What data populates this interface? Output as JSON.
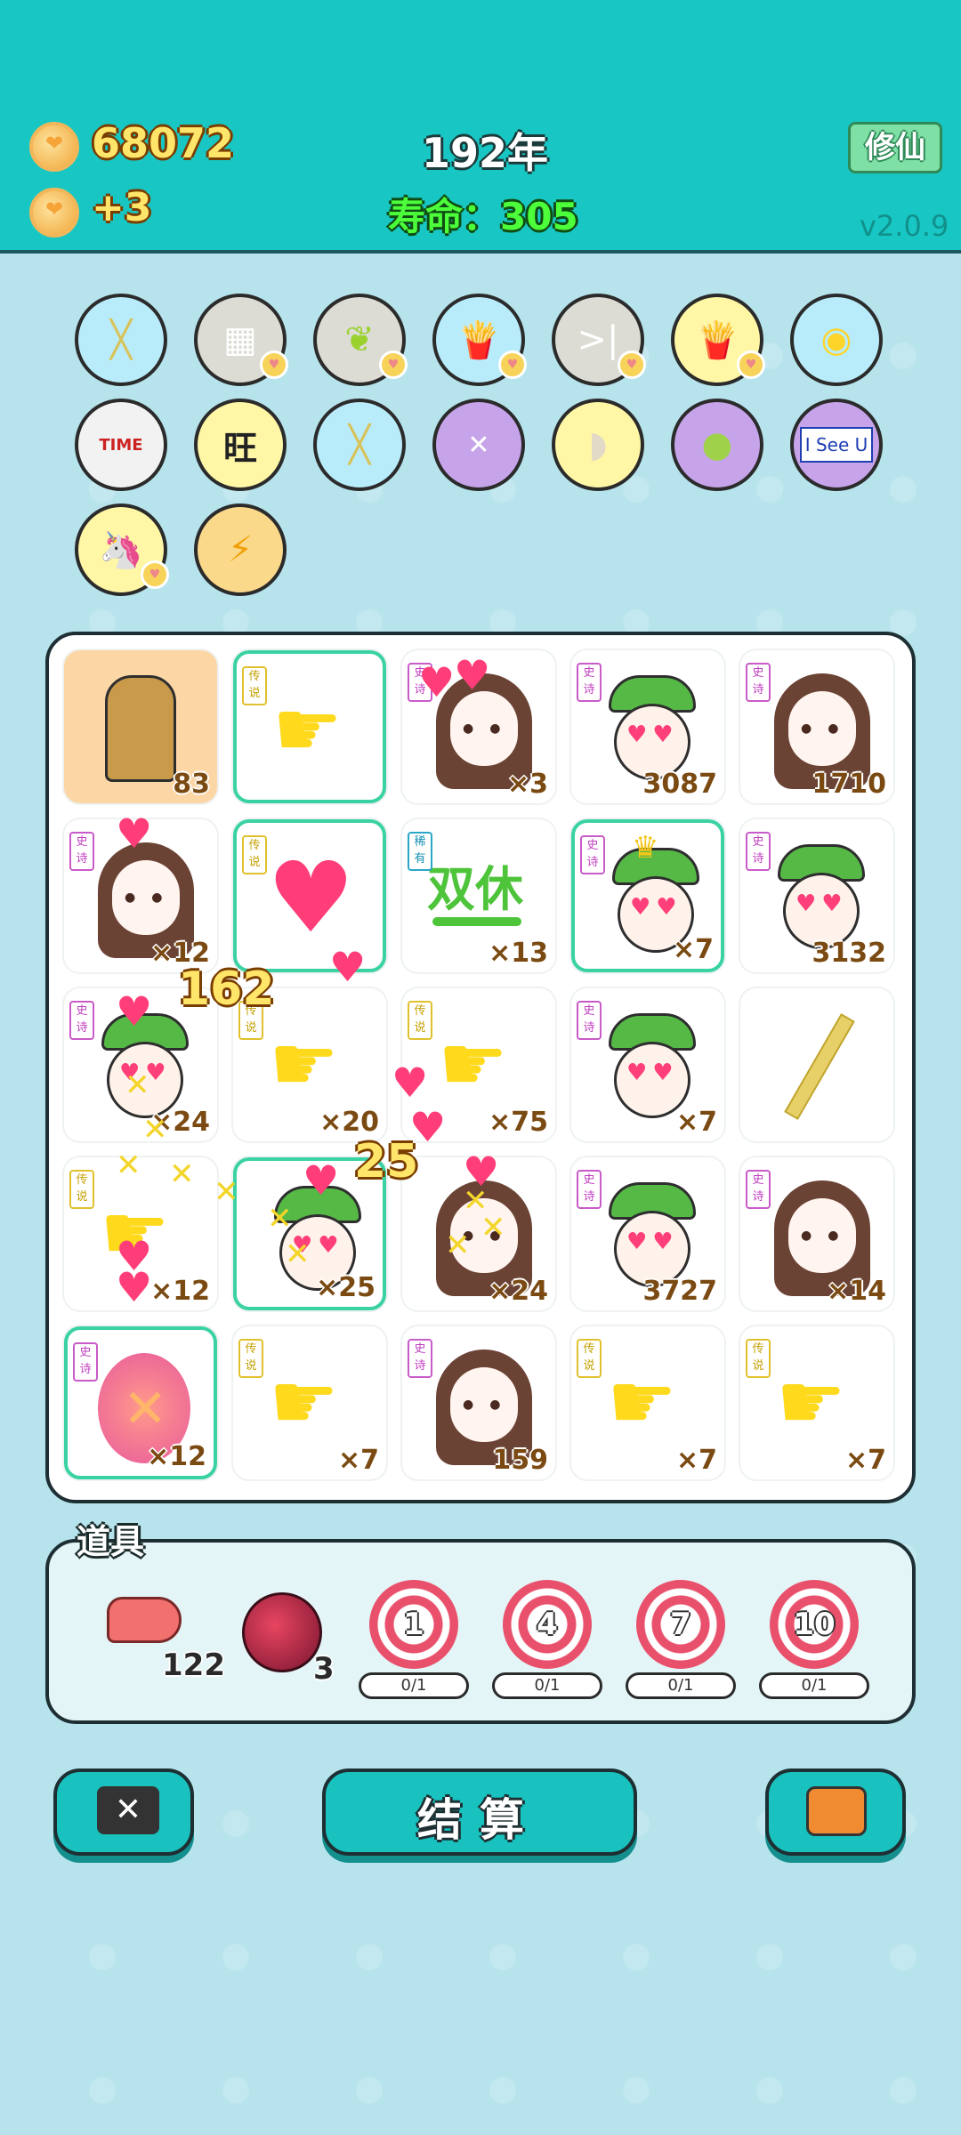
{
  "header": {
    "coins": "68072",
    "coin_rate": "+3",
    "year": "192年",
    "lifespan": "寿命：305",
    "cultivate_button": "修仙",
    "version": "v2.0.9"
  },
  "items_row1": [
    "chopsticks-icon",
    "sugar-cubes-icon",
    "leaf-icon",
    "fries-icon",
    "skip-icon",
    "fries-icon",
    "rice-cooker-icon"
  ],
  "items_row2": [
    "time-magazine-icon",
    "wang-text-icon",
    "chopsticks-icon",
    "math-head-icon",
    "shell-icon",
    "pomelo-icon",
    "isee-u-icon"
  ],
  "items_row3": [
    "unicorn-icon",
    "lightning-icon"
  ],
  "item_text": {
    "isee": "I See U",
    "wang": "旺",
    "time": "TIME"
  },
  "board": {
    "tiles": [
      {
        "tag": "",
        "count": "83",
        "kind": "bubble-tea"
      },
      {
        "tag": "传说",
        "count": "",
        "kind": "hand"
      },
      {
        "tag": "史诗",
        "count": "×3",
        "kind": "girl"
      },
      {
        "tag": "史诗",
        "count": "3087",
        "kind": "green-hat"
      },
      {
        "tag": "史诗",
        "count": "1710",
        "kind": "girl"
      },
      {
        "tag": "史诗",
        "count": "×12",
        "kind": "girl"
      },
      {
        "tag": "传说",
        "count": "",
        "kind": "hearts"
      },
      {
        "tag": "稀有",
        "count": "×13",
        "kind": "text"
      },
      {
        "tag": "史诗",
        "count": "×7",
        "kind": "king"
      },
      {
        "tag": "史诗",
        "count": "3132",
        "kind": "green-hat"
      },
      {
        "tag": "史诗",
        "count": "×24",
        "kind": "green-hat"
      },
      {
        "tag": "传说",
        "count": "×20",
        "kind": "hand"
      },
      {
        "tag": "传说",
        "count": "×75",
        "kind": "hand"
      },
      {
        "tag": "史诗",
        "count": "×7",
        "kind": "green-hat"
      },
      {
        "tag": "",
        "count": "",
        "kind": "chopstick"
      },
      {
        "tag": "传说",
        "count": "×12",
        "kind": "hand"
      },
      {
        "tag": "",
        "count": "×25",
        "kind": "green-hat"
      },
      {
        "tag": "",
        "count": "×24",
        "kind": "girl"
      },
      {
        "tag": "史诗",
        "count": "3727",
        "kind": "green-hat"
      },
      {
        "tag": "史诗",
        "count": "×14",
        "kind": "girl"
      },
      {
        "tag": "史诗",
        "count": "×12",
        "kind": "x-face"
      },
      {
        "tag": "传说",
        "count": "×7",
        "kind": "hand"
      },
      {
        "tag": "史诗",
        "count": "159",
        "kind": "girl"
      },
      {
        "tag": "传说",
        "count": "×7",
        "kind": "hand"
      },
      {
        "tag": "传说",
        "count": "×7",
        "kind": "hand"
      }
    ],
    "rest_text": "双休",
    "float_162": "162",
    "float_25": "25"
  },
  "tools": {
    "title": "道具",
    "liver_count": "122",
    "berry_count": "3",
    "targets": [
      {
        "level": "1",
        "progress": "0/1"
      },
      {
        "level": "4",
        "progress": "0/1"
      },
      {
        "level": "7",
        "progress": "0/1"
      },
      {
        "level": "10",
        "progress": "0/1"
      }
    ]
  },
  "buttons": {
    "settle": "结算"
  },
  "colors": {
    "header": "#18c7c3",
    "background": "#b6e3ec",
    "accent": "#19c2be"
  }
}
